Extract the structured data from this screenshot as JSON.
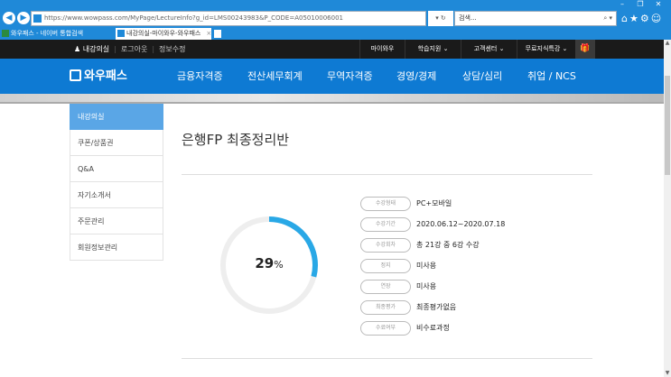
{
  "browser": {
    "url": "https://www.wowpass.com/MyPage/LectureInfo?g_id=LMS00243983&P_CODE=A05010006001",
    "search_placeholder": "검색...",
    "tabs": [
      {
        "label": "와우패스 - 네이버 통합검색"
      },
      {
        "label": "내강의실-마이와우-와우패스"
      }
    ]
  },
  "topbar": {
    "user": "내강의실",
    "logout": "로그아웃",
    "profile": "정보수정",
    "right_items": [
      "마이와우",
      "학습지원",
      "고객센터",
      "무료지식특강"
    ]
  },
  "brand": {
    "logo": "와우패스"
  },
  "mainnav": {
    "items": [
      "금융자격증",
      "전산세무회계",
      "무역자격증",
      "경영/경제",
      "상담/심리",
      "취업 / NCS"
    ]
  },
  "sidebar": {
    "items": [
      "내강의실",
      "쿠폰/상품권",
      "Q&A",
      "자기소개서",
      "주문관리",
      "회원정보관리"
    ]
  },
  "course": {
    "title": "은행FP 최종정리반",
    "progress_value": 29,
    "progress_label": "29",
    "progress_unit": "%",
    "details": [
      {
        "label": "수강형태",
        "value": "PC+모바일"
      },
      {
        "label": "수강기간",
        "value": "2020.06.12~2020.07.18"
      },
      {
        "label": "수강회차",
        "value": "총 21강 중 6강 수강"
      },
      {
        "label": "정지",
        "value": "미사용"
      },
      {
        "label": "연장",
        "value": "미사용"
      },
      {
        "label": "최종평가",
        "value": "최종평가없음"
      },
      {
        "label": "수료여부",
        "value": "비수료과정"
      }
    ]
  },
  "colors": {
    "accent": "#0e7ad3",
    "progress": "#29a8e6",
    "track": "#eeeeee"
  }
}
